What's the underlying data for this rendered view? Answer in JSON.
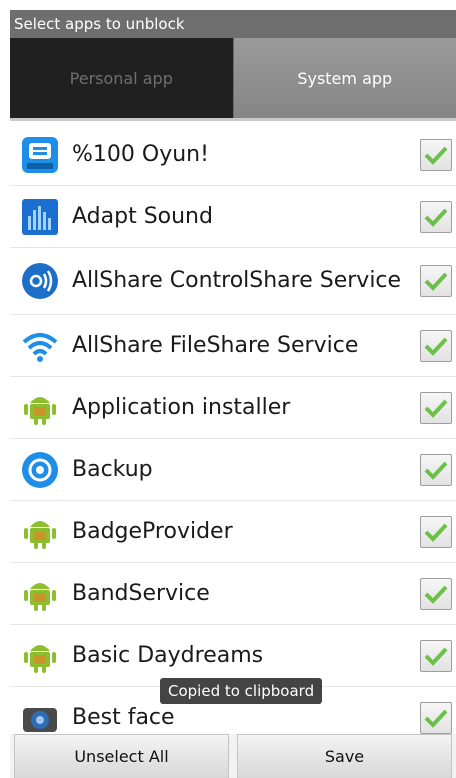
{
  "title_bar": {
    "title": "Select apps to unblock"
  },
  "tabs": [
    {
      "label": "Personal app",
      "selected": false
    },
    {
      "label": "System app",
      "selected": true
    }
  ],
  "apps": [
    {
      "name": "%100 Oyun!",
      "icon": "games-icon",
      "checked": true
    },
    {
      "name": "Adapt Sound",
      "icon": "adapt-sound-icon",
      "checked": true
    },
    {
      "name": "AllShare ControlShare Service",
      "icon": "allshare-control-icon",
      "checked": true
    },
    {
      "name": "AllShare FileShare Service",
      "icon": "wifi-icon",
      "checked": true
    },
    {
      "name": "Application installer",
      "icon": "android-icon",
      "checked": true
    },
    {
      "name": "Backup",
      "icon": "backup-icon",
      "checked": true
    },
    {
      "name": "BadgeProvider",
      "icon": "android-icon",
      "checked": true
    },
    {
      "name": "BandService",
      "icon": "android-icon",
      "checked": true
    },
    {
      "name": "Basic Daydreams",
      "icon": "android-icon",
      "checked": true
    },
    {
      "name": "Best face",
      "icon": "camera-icon",
      "checked": true
    }
  ],
  "toast": {
    "text": "Copied to clipboard"
  },
  "buttons": {
    "unselect_all": "Unselect All",
    "save": "Save"
  },
  "colors": {
    "accent_check": "#6cc04a",
    "title_bar": "#6e6e6e",
    "tab_dark": "#202020"
  }
}
